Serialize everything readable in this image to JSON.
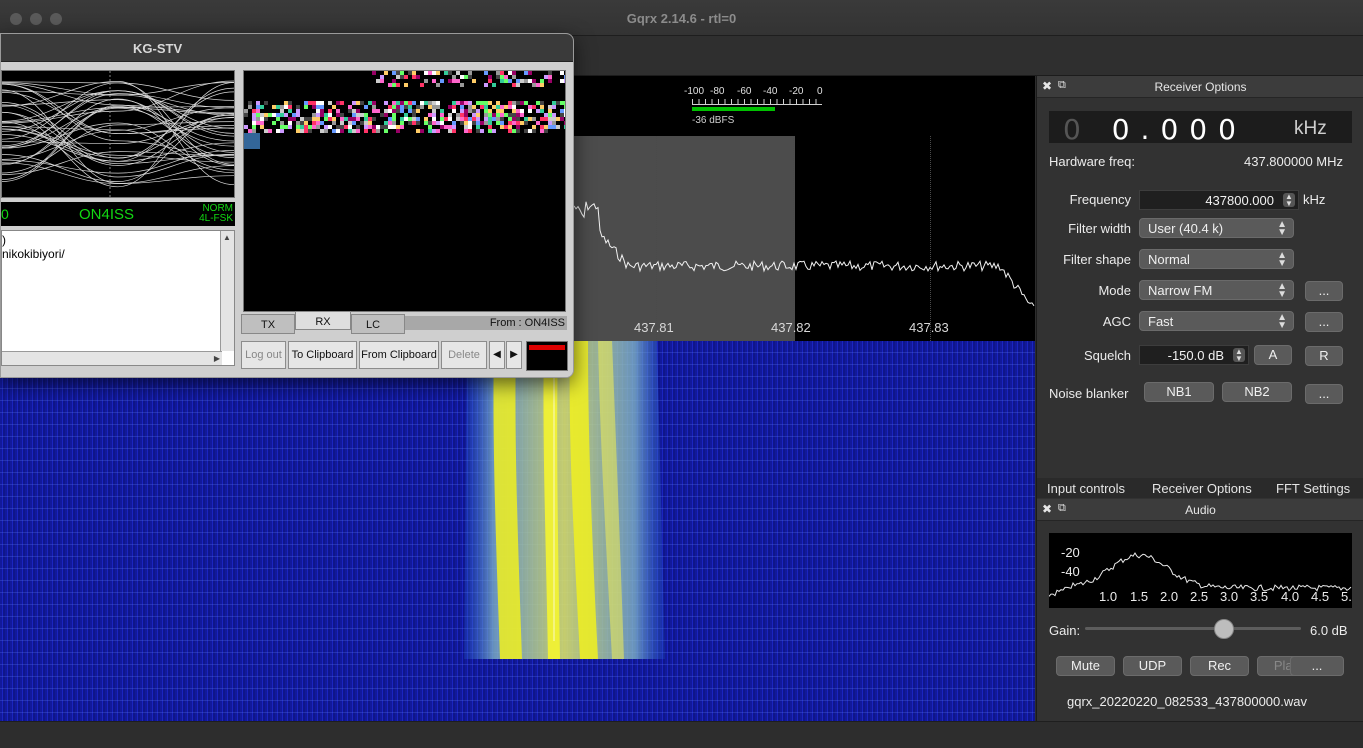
{
  "app": {
    "title": "Gqrx 2.14.6 - rtl=0"
  },
  "plotter": {
    "freq_ticks": [
      "437.81",
      "437.82",
      "437.83"
    ],
    "meter": {
      "scale": [
        "-100",
        "-80",
        "-60",
        "-40",
        "-20",
        "0"
      ],
      "level_dbfs": -36,
      "label": "-36 dBFS"
    }
  },
  "receiver_options": {
    "title": "Receiver Options",
    "freq_ghost": "0",
    "freq_digits": "0.000",
    "freq_unit": "kHz",
    "hardware_freq_label": "Hardware freq:",
    "hardware_freq_value": "437.800000 MHz",
    "frequency_label": "Frequency",
    "frequency_value": "437800.000",
    "frequency_unit": "kHz",
    "filter_width_label": "Filter width",
    "filter_width_value": "User (40.4 k)",
    "filter_shape_label": "Filter shape",
    "filter_shape_value": "Normal",
    "mode_label": "Mode",
    "mode_value": "Narrow FM",
    "agc_label": "AGC",
    "agc_value": "Fast",
    "squelch_label": "Squelch",
    "squelch_value": "-150.0 dB",
    "squelch_a": "A",
    "squelch_r": "R",
    "noise_blanker_label": "Noise blanker",
    "nb1": "NB1",
    "nb2": "NB2",
    "more": "...",
    "tabs": [
      "Input controls",
      "Receiver Options",
      "FFT Settings"
    ]
  },
  "audio": {
    "title": "Audio",
    "y_ticks": [
      "-20",
      "-40"
    ],
    "x_ticks": [
      "1.0",
      "1.5",
      "2.0",
      "2.5",
      "3.0",
      "3.5",
      "4.0",
      "4.5",
      "5."
    ],
    "gain_label": "Gain:",
    "gain_value": "6.0 dB",
    "gain_level": 0.65,
    "buttons": [
      "Mute",
      "UDP",
      "Rec",
      "Play",
      "..."
    ],
    "file_name": "gqrx_20220220_082533_437800000.wav"
  },
  "kgstv": {
    "title": "KG-STV",
    "status_left": "0",
    "callsign": "ON4ISS",
    "mode_line1": "NORM",
    "mode_line2": "4L-FSK",
    "text_lines": ")\nnikokibiyori/",
    "tabs": [
      "TX",
      "RX",
      "LC"
    ],
    "from": "From : ON4ISS",
    "buttons": [
      "Log out",
      "To Clipboard",
      "From Clipboard",
      "Delete"
    ],
    "prev": "◀",
    "next": "▶"
  },
  "colors": {
    "waterfall_base": "#1620a8",
    "signal": "#f0f020",
    "callsign_green": "#12d812"
  }
}
